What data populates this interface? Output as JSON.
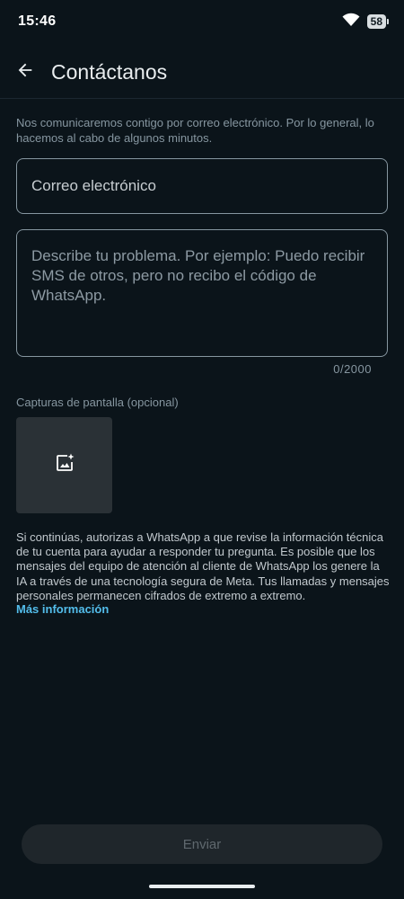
{
  "status_bar": {
    "time": "15:46",
    "battery": "58"
  },
  "header": {
    "title": "Contáctanos"
  },
  "intro_text": "Nos comunicaremos contigo por correo electrónico. Por lo general, lo hacemos al cabo de algunos minutos.",
  "form": {
    "email_placeholder": "Correo electrónico",
    "email_value": "",
    "description_placeholder": "Describe tu problema. Por ejemplo: Puedo recibir SMS de otros, pero no recibo el código de WhatsApp.",
    "description_value": "",
    "char_counter": "0/2000",
    "screenshots_label": "Capturas de pantalla (opcional)"
  },
  "disclaimer": "Si continúas, autorizas a WhatsApp a que revise la información técnica de tu cuenta para ayudar a responder tu pregunta. Es posible que los mensajes del equipo de atención al cliente de WhatsApp los genere la IA a través de una tecnología segura de Meta. Tus llamadas y mensajes personales permanecen cifrados de extremo a extremo.",
  "more_info_link": "Más información",
  "send_button": "Enviar",
  "icons": {
    "back": "arrow-back-icon",
    "wifi": "wifi-icon",
    "battery": "battery-icon",
    "add_image": "add-photo-icon"
  },
  "colors": {
    "background": "#0b141a",
    "accent_link": "#53bdeb",
    "border": "#8696a0"
  }
}
